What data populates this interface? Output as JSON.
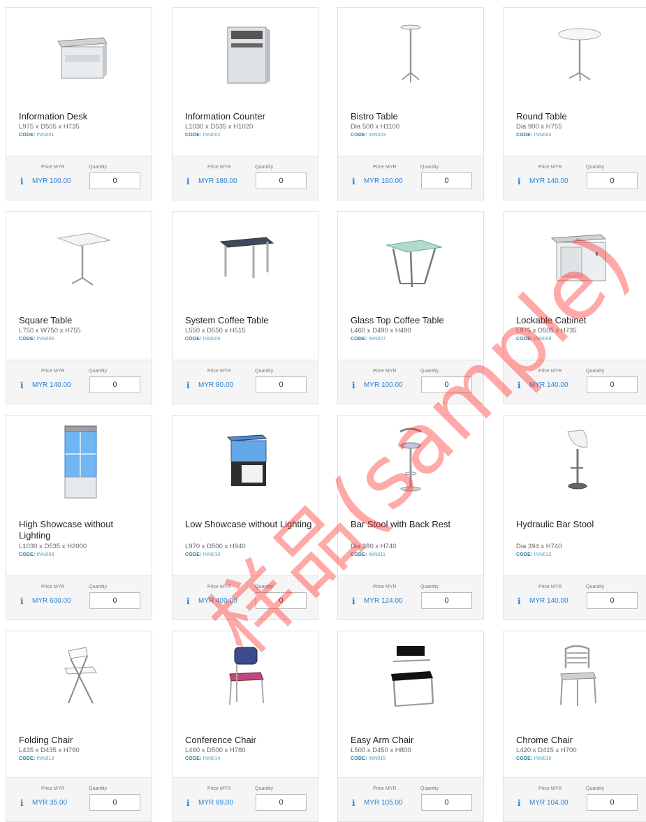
{
  "labels": {
    "price": "Price MYR",
    "quantity": "Quantity"
  },
  "watermark": "样品(sample)",
  "products": [
    {
      "name": "Information Desk",
      "dims": "L975 x D505 x H735",
      "code_label": "CODE:",
      "code": "INN001",
      "price": "MYR 100.00",
      "qty": "0",
      "icon": "desk"
    },
    {
      "name": "Information Counter",
      "dims": "L1030 x D535 x H1020",
      "code_label": "CODE:",
      "code": "INN002",
      "price": "MYR 180.00",
      "qty": "0",
      "icon": "counter"
    },
    {
      "name": "Bistro Table",
      "dims": "Dia 500 x H1100",
      "code_label": "CODE:",
      "code": "INN003",
      "price": "MYR 160.00",
      "qty": "0",
      "icon": "bistro"
    },
    {
      "name": "Round Table",
      "dims": "Dia 900 x H755",
      "code_label": "CODE:",
      "code": "INN004",
      "price": "MYR 140.00",
      "qty": "0",
      "icon": "roundtable"
    },
    {
      "name": "Square Table",
      "dims": "L750 x W750 x H755",
      "code_label": "CODE:",
      "code": "INN005",
      "price": "MYR 140.00",
      "qty": "0",
      "icon": "squaretable"
    },
    {
      "name": "System Coffee Table",
      "dims": "L550 x D550 x H515",
      "code_label": "CODE:",
      "code": "INN006",
      "price": "MYR 80.00",
      "qty": "0",
      "icon": "coffeetable"
    },
    {
      "name": "Glass Top Coffee Table",
      "dims": "L460 x D490 x H490",
      "code_label": "CODE:",
      "code": "INN007",
      "price": "MYR 100.00",
      "qty": "0",
      "icon": "glasstable"
    },
    {
      "name": "Lockable Cabinet",
      "dims": "L975 x D505 x H735",
      "code_label": "CODE:",
      "code": "INN008",
      "price": "MYR 140.00",
      "qty": "0",
      "icon": "cabinet"
    },
    {
      "name": "High Showcase without Lighting",
      "dims": "L1030 x D535 x H2000",
      "code_label": "CODE:",
      "code": "INN009",
      "price": "MYR 600.00",
      "qty": "0",
      "icon": "highshowcase"
    },
    {
      "name": "Low Showcase without Lighting",
      "dims": "L970 x D500 x H940",
      "code_label": "CODE:",
      "code": "INN010",
      "price": "MYR 400.00",
      "qty": "0",
      "icon": "lowshowcase"
    },
    {
      "name": "Bar Stool with Back Rest",
      "dims": "Dia 380 x H740",
      "code_label": "CODE:",
      "code": "INN011",
      "price": "MYR 124.00",
      "qty": "0",
      "icon": "barstool"
    },
    {
      "name": "Hydraulic Bar Stool",
      "dims": "Dia 394 x H740",
      "code_label": "CODE:",
      "code": "INN012",
      "price": "MYR 140.00",
      "qty": "0",
      "icon": "hydraulicstool"
    },
    {
      "name": "Folding Chair",
      "dims": "L435 x D435 x H790",
      "code_label": "CODE:",
      "code": "INN013",
      "price": "MYR 35.00",
      "qty": "0",
      "icon": "foldingchair"
    },
    {
      "name": "Conference Chair",
      "dims": "L460 x D500 x H780",
      "code_label": "CODE:",
      "code": "INN014",
      "price": "MYR 89.00",
      "qty": "0",
      "icon": "conferencechair"
    },
    {
      "name": "Easy Arm Chair",
      "dims": "L500 x D450 x H800",
      "code_label": "CODE:",
      "code": "INN015",
      "price": "MYR 105.00",
      "qty": "0",
      "icon": "armchair"
    },
    {
      "name": "Chrome Chair",
      "dims": "L420 x D415 x H700",
      "code_label": "CODE:",
      "code": "INN016",
      "price": "MYR 104.00",
      "qty": "0",
      "icon": "chromechair"
    }
  ]
}
